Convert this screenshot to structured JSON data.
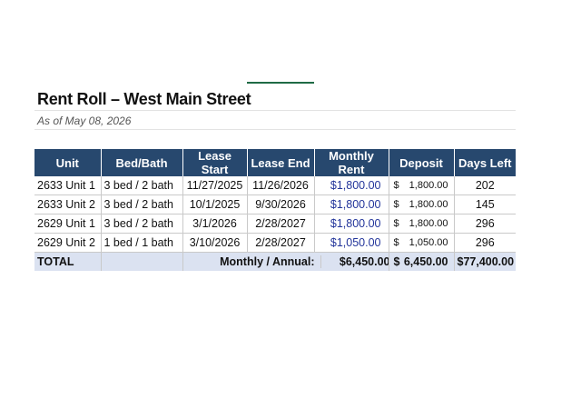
{
  "sheet": {
    "title": "Rent Roll – West Main Street",
    "subtitle": "As of May 08, 2026"
  },
  "table": {
    "headers": [
      "Unit",
      "Bed/Bath",
      "Lease Start",
      "Lease End",
      "Monthly Rent",
      "Deposit",
      "Days Left"
    ],
    "rows": [
      {
        "unit": "2633 Unit 1",
        "bedbath": "3 bed / 2 bath",
        "start": "11/27/2025",
        "end": "11/26/2026",
        "rent": "$1,800.00",
        "deposit_symbol": "$",
        "deposit": "1,800.00",
        "days": "202"
      },
      {
        "unit": "2633 Unit 2",
        "bedbath": "3 bed / 2 bath",
        "start": "10/1/2025",
        "end": "9/30/2026",
        "rent": "$1,800.00",
        "deposit_symbol": "$",
        "deposit": "1,800.00",
        "days": "145"
      },
      {
        "unit": "2629 Unit 1",
        "bedbath": "3 bed / 2 bath",
        "start": "3/1/2026",
        "end": "2/28/2027",
        "rent": "$1,800.00",
        "deposit_symbol": "$",
        "deposit": "1,800.00",
        "days": "296"
      },
      {
        "unit": "2629 Unit 2",
        "bedbath": "1 bed / 1 bath",
        "start": "3/10/2026",
        "end": "2/28/2027",
        "rent": "$1,050.00",
        "deposit_symbol": "$",
        "deposit": "1,050.00",
        "days": "296"
      }
    ],
    "total": {
      "label": "TOTAL",
      "caption": "Monthly / Annual:",
      "rent": "$6,450.00",
      "deposit_symbol": "$",
      "deposit": "6,450.00",
      "annual": "$77,400.00"
    }
  },
  "colors": {
    "header_bg": "#27486e",
    "total_bg": "#dbe2f1",
    "rent_text": "#22349a",
    "selection_marker": "#1f6b45"
  }
}
